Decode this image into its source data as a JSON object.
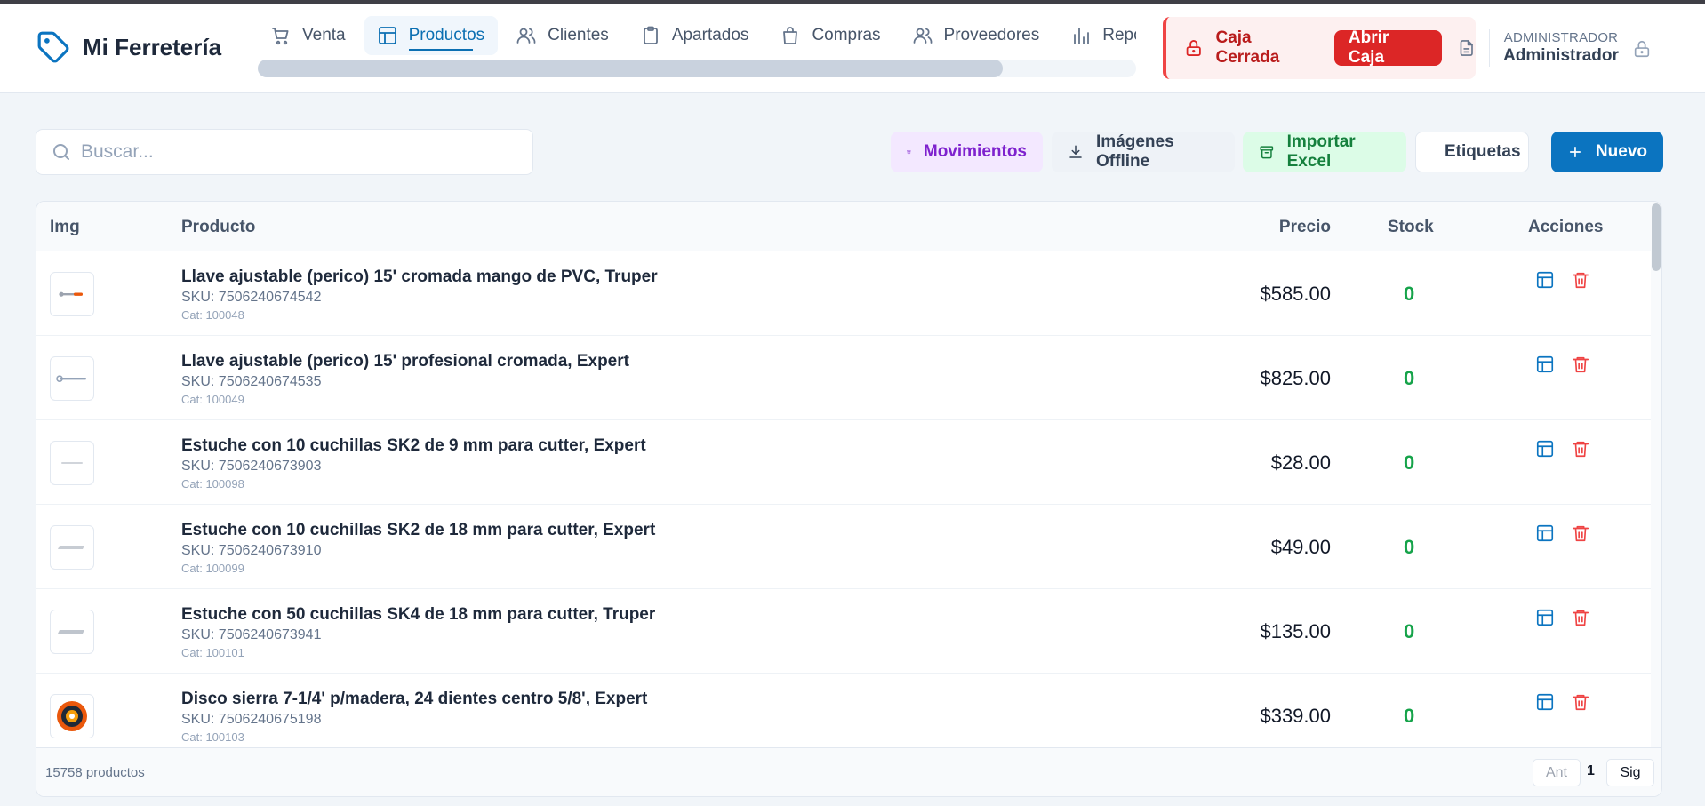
{
  "app": {
    "name": "Mi Ferretería",
    "logo_icon": "tag-icon"
  },
  "nav": {
    "items": [
      {
        "label": "Venta",
        "icon": "cart-icon",
        "active": false
      },
      {
        "label": "Productos",
        "icon": "layout-icon",
        "active": true
      },
      {
        "label": "Clientes",
        "icon": "users-icon",
        "active": false
      },
      {
        "label": "Apartados",
        "icon": "clipboard-icon",
        "active": false
      },
      {
        "label": "Compras",
        "icon": "bag-icon",
        "active": false
      },
      {
        "label": "Proveedores",
        "icon": "users-icon",
        "active": false
      },
      {
        "label": "Reportes",
        "icon": "bar-chart-icon",
        "active": false
      }
    ]
  },
  "caja": {
    "status": "Caja Cerrada",
    "open_label": "Abrir Caja"
  },
  "user": {
    "role": "ADMINISTRADOR",
    "name": "Administrador"
  },
  "search": {
    "placeholder": "Buscar..."
  },
  "toolbar": {
    "movimientos": "Movimientos",
    "imagenes": "Imágenes Offline",
    "importar": "Importar Excel",
    "etiquetas": "Etiquetas",
    "nuevo": "Nuevo"
  },
  "table": {
    "headers": {
      "img": "Img",
      "producto": "Producto",
      "precio": "Precio",
      "stock": "Stock",
      "acciones": "Acciones"
    },
    "rows": [
      {
        "name": "Llave ajustable (perico) 15' cromada mango de PVC, Truper",
        "sku": "SKU: 7506240674542",
        "cat": "Cat: 100048",
        "price": "$585.00",
        "stock": "0",
        "thumb": "wrench-icon"
      },
      {
        "name": "Llave ajustable (perico) 15' profesional cromada, Expert",
        "sku": "SKU: 7506240674535",
        "cat": "Cat: 100049",
        "price": "$825.00",
        "stock": "0",
        "thumb": "wrench-icon"
      },
      {
        "name": "Estuche con 10 cuchillas SK2 de 9 mm para cutter, Expert",
        "sku": "SKU: 7506240673903",
        "cat": "Cat: 100098",
        "price": "$28.00",
        "stock": "0",
        "thumb": "blade-icon"
      },
      {
        "name": "Estuche con 10 cuchillas SK2 de 18 mm para cutter, Expert",
        "sku": "SKU: 7506240673910",
        "cat": "Cat: 100099",
        "price": "$49.00",
        "stock": "0",
        "thumb": "blade-icon"
      },
      {
        "name": "Estuche con 50 cuchillas SK4 de 18 mm para cutter, Truper",
        "sku": "SKU: 7506240673941",
        "cat": "Cat: 100101",
        "price": "$135.00",
        "stock": "0",
        "thumb": "blade-icon"
      },
      {
        "name": "Disco sierra 7-1/4' p/madera, 24 dientes centro 5/8', Expert",
        "sku": "SKU: 7506240675198",
        "cat": "Cat: 100103",
        "price": "$339.00",
        "stock": "0",
        "thumb": "saw-disc-icon"
      }
    ]
  },
  "footer": {
    "count": "15758 productos",
    "prev": "Ant",
    "page": "1",
    "next": "Sig"
  }
}
